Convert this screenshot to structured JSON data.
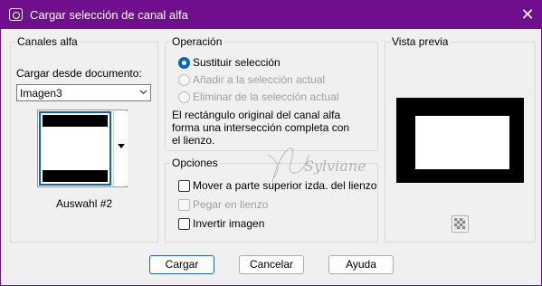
{
  "window": {
    "title": "Cargar selección de canal alfa"
  },
  "channels": {
    "legend": "Canales alfa",
    "load_label": "Cargar desde documento:",
    "document_value": "Imagen3",
    "thumbnail_caption": "Auswahl #2"
  },
  "operation": {
    "legend": "Operación",
    "options": [
      {
        "label": "Sustituir selección",
        "checked": true,
        "enabled": true
      },
      {
        "label": "Añadir a la selección actual",
        "checked": false,
        "enabled": false
      },
      {
        "label": "Eliminar de la selección actual",
        "checked": false,
        "enabled": false
      }
    ],
    "description_lines": [
      "El rectángulo original del canal alfa",
      "forma una intersección completa con",
      "el lienzo."
    ]
  },
  "options": {
    "legend": "Opciones",
    "items": [
      {
        "label": "Mover a parte superior izda. del lienzo",
        "checked": false,
        "enabled": true
      },
      {
        "label": "Pegar en lienzo",
        "checked": false,
        "enabled": false
      },
      {
        "label": "Invertir imagen",
        "checked": false,
        "enabled": true
      }
    ]
  },
  "preview": {
    "legend": "Vista previa"
  },
  "buttons": {
    "load": "Cargar",
    "cancel": "Cancelar",
    "help": "Ayuda"
  },
  "watermark_text": "Sylviane",
  "colors": {
    "titlebar": "#6f0f8e",
    "accent": "#0067c0"
  }
}
